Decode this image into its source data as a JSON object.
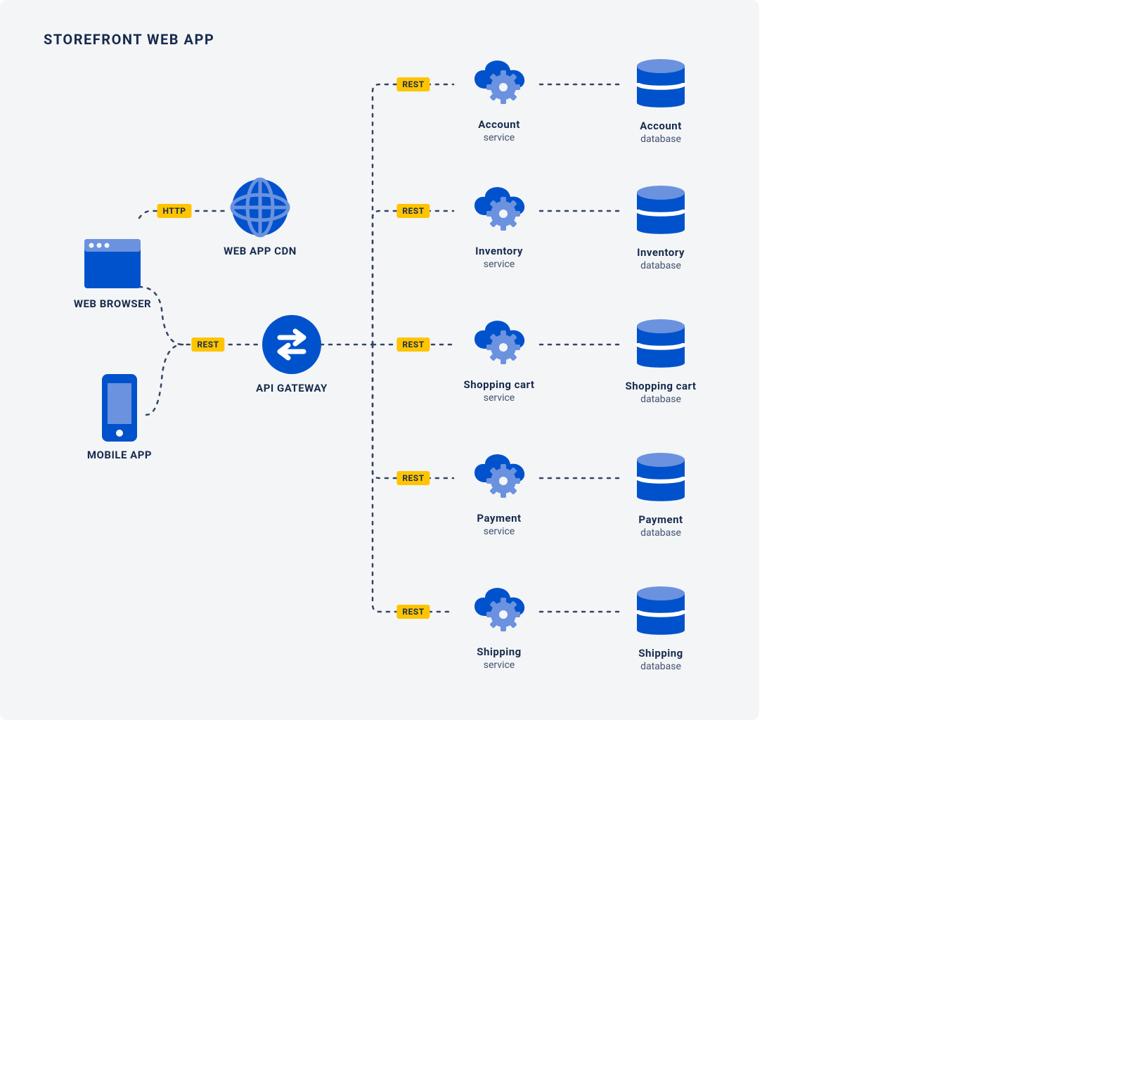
{
  "colors": {
    "primary": "#0052CC",
    "light": "#6B92DF",
    "badge_bg": "#FFC400",
    "badge_fg": "#172B4D",
    "text": "#172B4D",
    "text2": "#42526E",
    "dash": "#172B4D"
  },
  "title": "STOREFRONT WEB APP",
  "nodes": {
    "web_browser": {
      "label": "WEB BROWSER"
    },
    "mobile_app": {
      "label": "MOBILE APP"
    },
    "web_app_cdn": {
      "label": "WEB APP CDN"
    },
    "api_gateway": {
      "label": "API GATEWAY"
    },
    "services": [
      {
        "name": "Account",
        "sub": "service"
      },
      {
        "name": "Inventory",
        "sub": "service"
      },
      {
        "name": "Shopping cart",
        "sub": "service"
      },
      {
        "name": "Payment",
        "sub": "service"
      },
      {
        "name": "Shipping",
        "sub": "service"
      }
    ],
    "databases": [
      {
        "name": "Account",
        "sub": "database"
      },
      {
        "name": "Inventory",
        "sub": "database"
      },
      {
        "name": "Shopping cart",
        "sub": "database"
      },
      {
        "name": "Payment",
        "sub": "database"
      },
      {
        "name": "Shipping",
        "sub": "database"
      }
    ]
  },
  "edges": {
    "browser_cdn": "HTTP",
    "clients_gateway": "REST",
    "gateway_services": [
      "REST",
      "REST",
      "REST",
      "REST",
      "REST"
    ]
  }
}
